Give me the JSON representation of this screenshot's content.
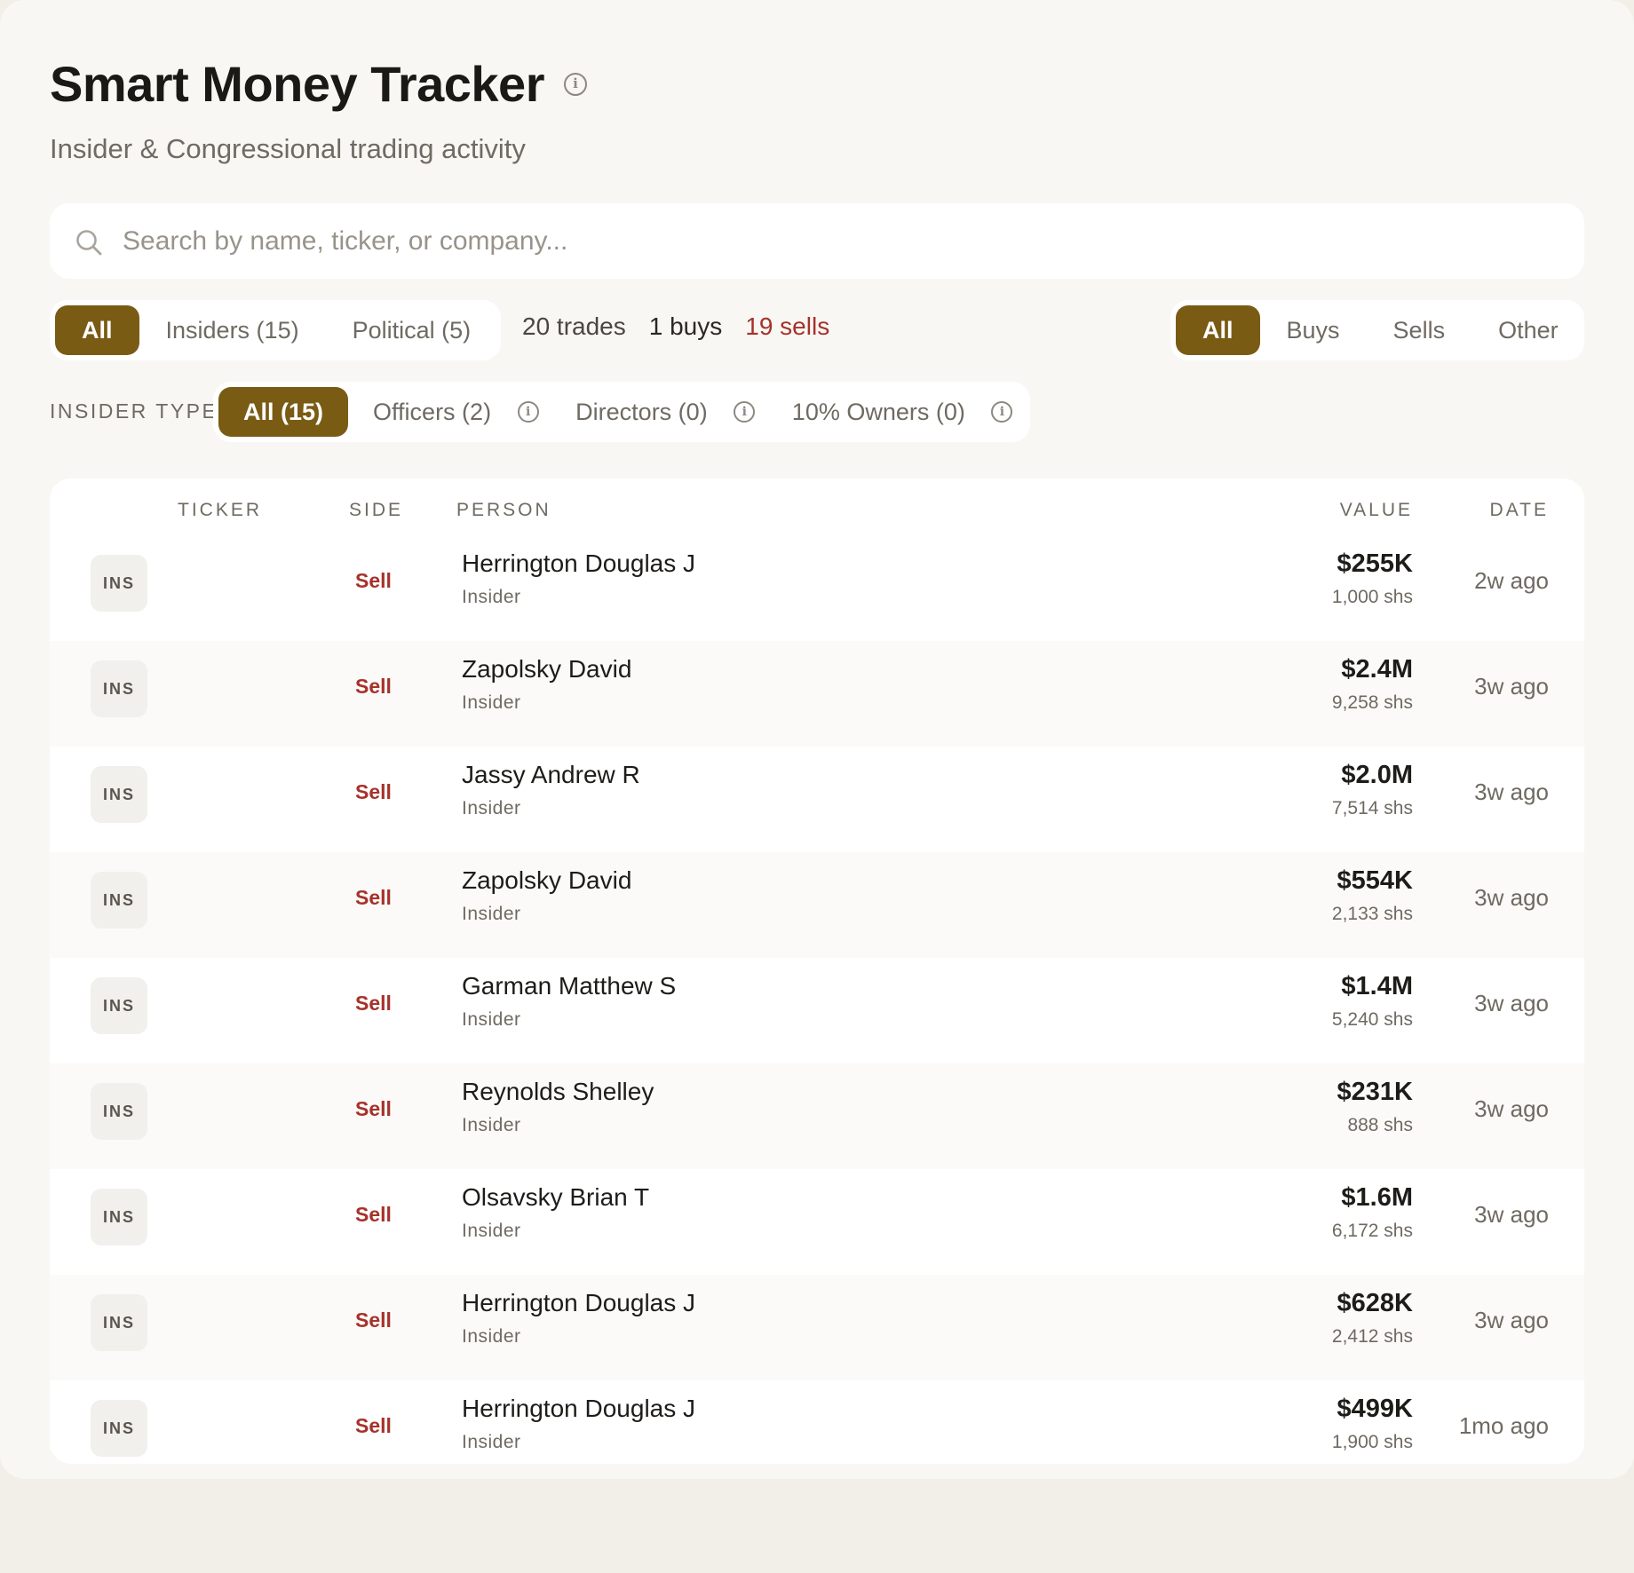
{
  "header": {
    "title": "Smart Money Tracker",
    "subtitle": "Insider & Congressional trading activity"
  },
  "search": {
    "placeholder": "Search by name, ticker, or company...",
    "value": ""
  },
  "source_filter": {
    "options": [
      "All",
      "Insiders (15)",
      "Political (5)"
    ],
    "selected": "All"
  },
  "stats": {
    "trades": "20 trades",
    "buys": "1 buys",
    "sells": "19 sells"
  },
  "side_filter": {
    "options": [
      "All",
      "Buys",
      "Sells",
      "Other"
    ],
    "selected": "All"
  },
  "insider_type": {
    "label": "INSIDER TYPE",
    "options": [
      "All (15)",
      "Officers (2)",
      "Directors (0)",
      "10% Owners (0)"
    ],
    "selected": "All (15)"
  },
  "table": {
    "columns": [
      "TICKER",
      "SIDE",
      "PERSON",
      "VALUE",
      "DATE"
    ],
    "rows": [
      {
        "badge": "INS",
        "side": "Sell",
        "name": "Herrington Douglas J",
        "role": "Insider",
        "value": "$255K",
        "shares": "1,000 shs",
        "date": "2w ago"
      },
      {
        "badge": "INS",
        "side": "Sell",
        "name": "Zapolsky David",
        "role": "Insider",
        "value": "$2.4M",
        "shares": "9,258 shs",
        "date": "3w ago"
      },
      {
        "badge": "INS",
        "side": "Sell",
        "name": "Jassy Andrew R",
        "role": "Insider",
        "value": "$2.0M",
        "shares": "7,514 shs",
        "date": "3w ago"
      },
      {
        "badge": "INS",
        "side": "Sell",
        "name": "Zapolsky David",
        "role": "Insider",
        "value": "$554K",
        "shares": "2,133 shs",
        "date": "3w ago"
      },
      {
        "badge": "INS",
        "side": "Sell",
        "name": "Garman Matthew S",
        "role": "Insider",
        "value": "$1.4M",
        "shares": "5,240 shs",
        "date": "3w ago"
      },
      {
        "badge": "INS",
        "side": "Sell",
        "name": "Reynolds Shelley",
        "role": "Insider",
        "value": "$231K",
        "shares": "888 shs",
        "date": "3w ago"
      },
      {
        "badge": "INS",
        "side": "Sell",
        "name": "Olsavsky Brian T",
        "role": "Insider",
        "value": "$1.6M",
        "shares": "6,172 shs",
        "date": "3w ago"
      },
      {
        "badge": "INS",
        "side": "Sell",
        "name": "Herrington Douglas J",
        "role": "Insider",
        "value": "$628K",
        "shares": "2,412 shs",
        "date": "3w ago"
      },
      {
        "badge": "INS",
        "side": "Sell",
        "name": "Herrington Douglas J",
        "role": "Insider",
        "value": "$499K",
        "shares": "1,900 shs",
        "date": "1mo ago"
      }
    ]
  },
  "colors": {
    "accent": "#7a5b14",
    "sell": "#a6322b",
    "page_bg": "#f8f7f4",
    "muted_text": "#6f6a62"
  },
  "icons": [
    "info-icon",
    "search-icon"
  ]
}
